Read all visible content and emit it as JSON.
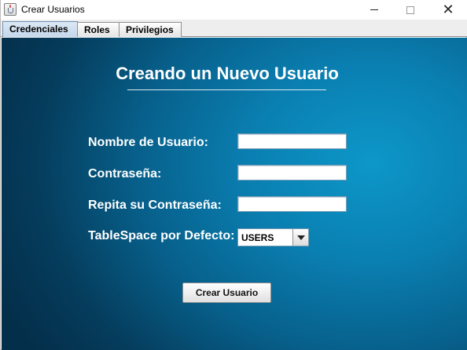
{
  "window": {
    "title": "Crear Usuarios"
  },
  "tabs": [
    {
      "label": "Credenciales",
      "selected": true
    },
    {
      "label": "Roles",
      "selected": false
    },
    {
      "label": "Privilegios",
      "selected": false
    }
  ],
  "form": {
    "heading": "Creando un Nuevo Usuario",
    "username_label": "Nombre de Usuario:",
    "username_value": "",
    "password_label": "Contraseña:",
    "password_value": "",
    "repeat_password_label": "Repita su Contraseña:",
    "repeat_password_value": "",
    "tablespace_label": "TableSpace por Defecto:",
    "tablespace_selected": "USERS",
    "submit_label": "Crear Usuario"
  },
  "colors": {
    "panel_light": "#0d97c9",
    "panel_dark": "#042f4a",
    "text": "#ffffff"
  }
}
